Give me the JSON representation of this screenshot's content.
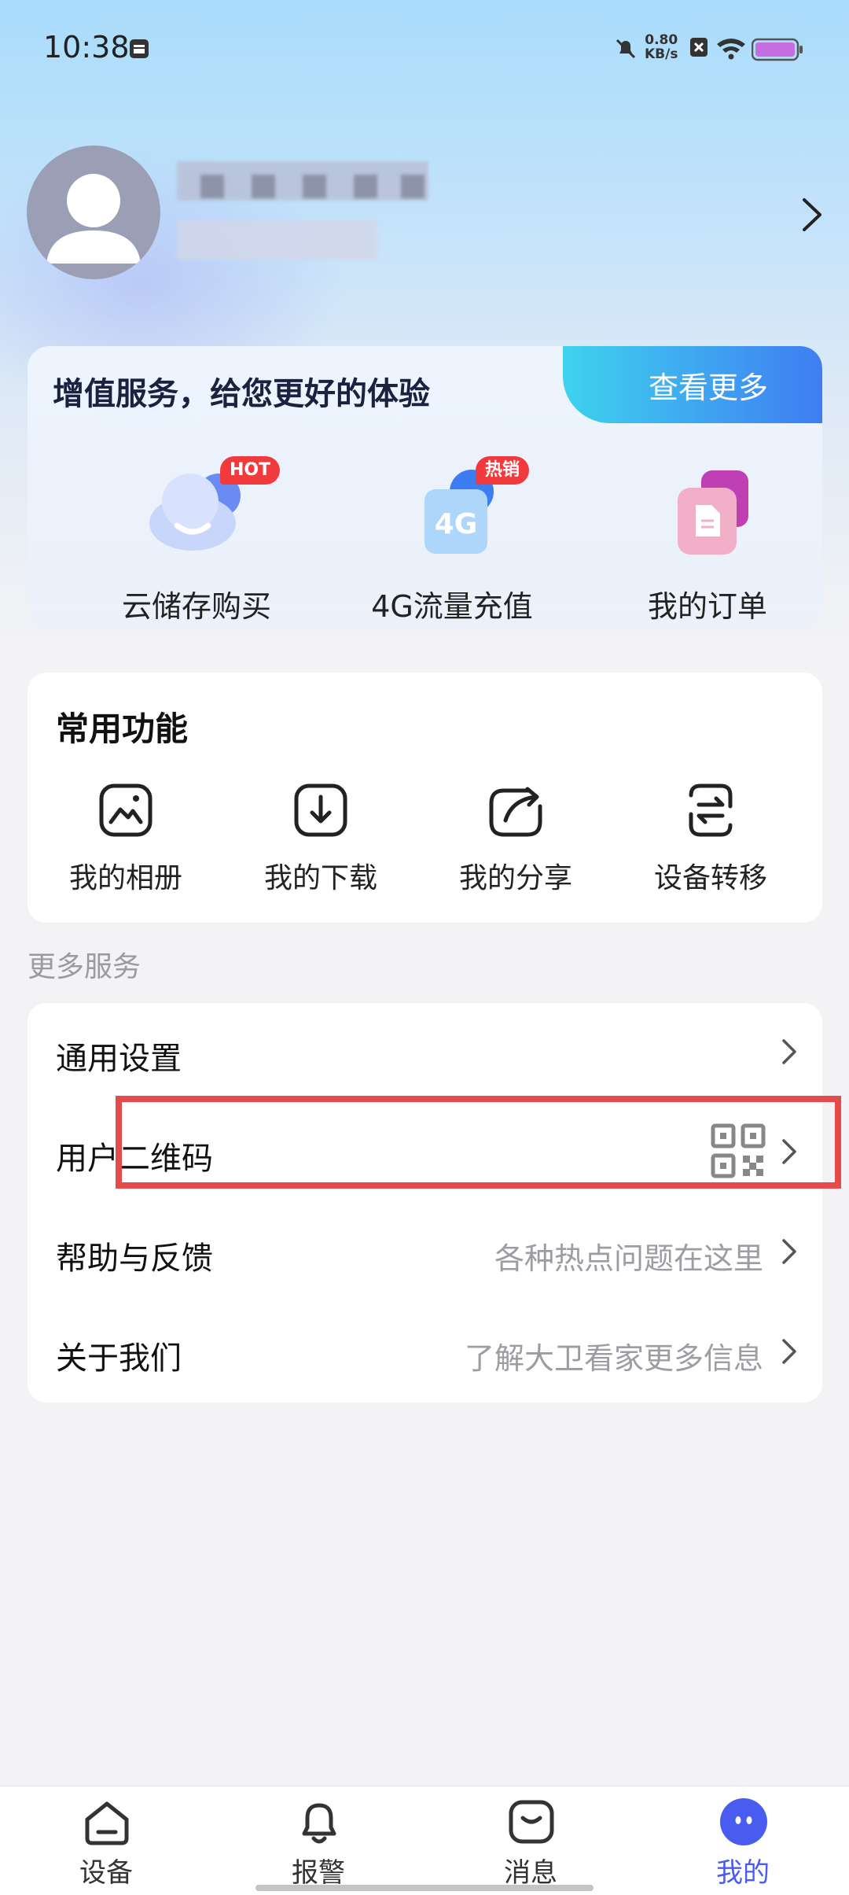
{
  "status_bar": {
    "time": "10:38",
    "net_speed_value": "0.80",
    "net_speed_unit": "KB/s"
  },
  "profile": {
    "name_blurred": true
  },
  "vas": {
    "title": "增值服务，给您更好的体验",
    "more_label": "查看更多",
    "items": [
      {
        "label": "云储存购买",
        "badge": "HOT",
        "icon": "cloud-icon"
      },
      {
        "label": "4G流量充值",
        "badge": "热销",
        "icon": "4g-icon"
      },
      {
        "label": "我的订单",
        "badge": "",
        "icon": "order-icon"
      }
    ]
  },
  "common": {
    "title": "常用功能",
    "items": [
      {
        "label": "我的相册",
        "icon": "album-icon"
      },
      {
        "label": "我的下载",
        "icon": "download-icon"
      },
      {
        "label": "我的分享",
        "icon": "share-icon"
      },
      {
        "label": "设备转移",
        "icon": "transfer-icon"
      }
    ]
  },
  "more_services": {
    "section_label": "更多服务",
    "rows": [
      {
        "label": "通用设置",
        "hint": ""
      },
      {
        "label": "用户二维码",
        "hint": ""
      },
      {
        "label": "帮助与反馈",
        "hint": "各种热点问题在这里"
      },
      {
        "label": "关于我们",
        "hint": "了解大卫看家更多信息"
      }
    ]
  },
  "tabbar": {
    "items": [
      {
        "label": "设备",
        "icon": "device-icon",
        "active": false
      },
      {
        "label": "报警",
        "icon": "bell-icon",
        "active": false
      },
      {
        "label": "消息",
        "icon": "message-icon",
        "active": false
      },
      {
        "label": "我的",
        "icon": "profile-icon",
        "active": true
      }
    ]
  },
  "colors": {
    "accent": "#4a5cf0",
    "highlight_box": "#e64a4a",
    "badge_red": "#f23a3c"
  }
}
